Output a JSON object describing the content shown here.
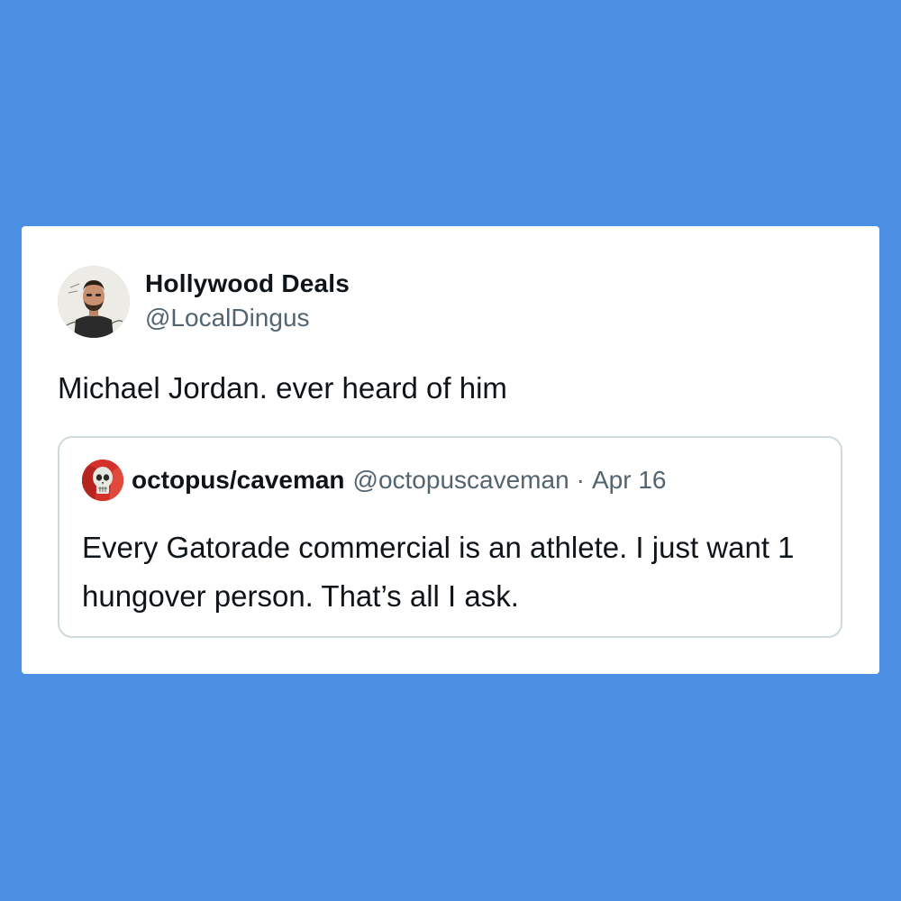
{
  "colors": {
    "background": "#4a8fe2",
    "card": "#ffffff",
    "text_primary": "#0f1419",
    "text_secondary": "#536471",
    "quote_border": "#cfd9de"
  },
  "tweet": {
    "author": {
      "display_name": "Hollywood Deals",
      "handle": "@LocalDingus",
      "avatar_icon": "user-photo-avatar"
    },
    "text": "Michael Jordan. ever heard of him"
  },
  "quoted_tweet": {
    "author": {
      "display_name": "octopus/caveman",
      "handle": "@octopuscaveman",
      "avatar_icon": "skull-avatar"
    },
    "separator": "·",
    "date": "Apr 16",
    "text": "Every Gatorade commercial is an athlete. I just want 1 hungover person. That’s all I ask."
  }
}
